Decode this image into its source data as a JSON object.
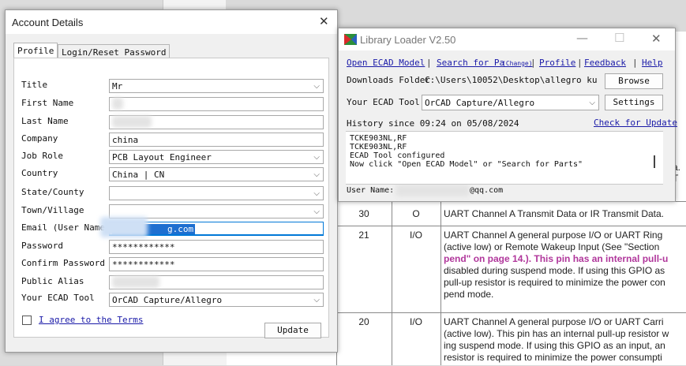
{
  "account": {
    "title": "Account Details",
    "tabs": [
      "Profile",
      "Login/Reset Password"
    ],
    "labels": {
      "title": "Title",
      "first_name": "First Name",
      "last_name": "Last Name",
      "company": "Company",
      "job_role": "Job Role",
      "country": "Country",
      "state": "State/County",
      "town": "Town/Village",
      "email": "Email (User Name)",
      "password": "Password",
      "confirm_password": "Confirm Password",
      "public_alias": "Public Alias",
      "ecad_tool": "Your ECAD Tool"
    },
    "values": {
      "title": "Mr",
      "company": "china",
      "job_role": "PCB Layout Engineer",
      "country": "China | CN",
      "state": "",
      "town": "",
      "email_visible": "g.com",
      "password": "************",
      "confirm_password": "************",
      "ecad_tool": "OrCAD Capture/Allegro"
    },
    "agree_label": "I agree to the Terms",
    "update_label": "Update"
  },
  "loader": {
    "title": "Library Loader V2.50",
    "links": {
      "open_model": "Open ECAD Model",
      "search": "Search for Pa",
      "change": "(Change)",
      "profile": "Profile",
      "feedback": "Feedback",
      "help": "Help"
    },
    "downloads_label": "Downloads Folder",
    "downloads_path": "C:\\Users\\10052\\Desktop\\allegro ku",
    "browse_label": "Browse",
    "ecad_label": "Your ECAD Tool",
    "ecad_value": "OrCAD Capture/Allegro",
    "settings_label": "Settings",
    "history_label": "History since 09:24 on 05/08/2024",
    "check_update": "Check for Update",
    "log": [
      "TCKE903NL,RF",
      "TCKE903NL,RF",
      "ECAD Tool configured",
      "Now click \"Open ECAD Model\" or \"Search for Parts\""
    ],
    "user_label": "User Name:",
    "user_suffix": "@qq.com"
  },
  "document": {
    "partial_top": "a. T",
    "rows": [
      {
        "pin": "30",
        "type": "O",
        "desc": [
          "UART Channel A Transmit Data or IR Transmit Data."
        ]
      },
      {
        "pin": "21",
        "type": "I/O",
        "desc": [
          "UART Channel A general purpose I/O or UART Ring",
          "(active low) or Remote Wakeup Input (See \"Section",
          "pend\" on page 14.). This pin has an internal pull-u",
          "disabled during suspend mode.  If using this GPIO as",
          "pull-up resistor is required to minimize the power con",
          "pend mode."
        ]
      },
      {
        "pin": "20",
        "type": "I/O",
        "desc": [
          "UART Channel A general purpose I/O or UART Carri",
          "(active low). This pin has an internal pull-up resistor w",
          "ing suspend mode. If using this GPIO as an input, an",
          "resistor is required to minimize the power consumpti"
        ]
      }
    ]
  }
}
